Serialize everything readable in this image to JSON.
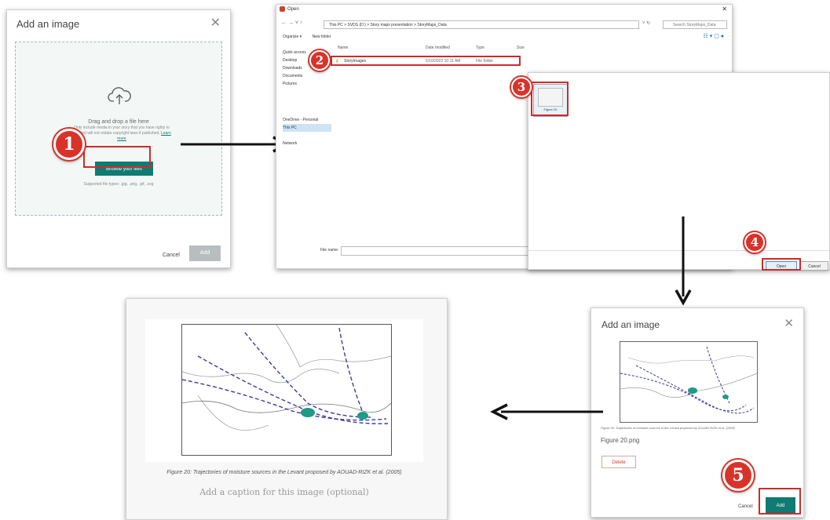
{
  "panel1": {
    "title": "Add an image",
    "drag_text": "Drag and drop a file here",
    "info_text": "Only include media in your story that you have rights to use and will not violate copyright laws if published.",
    "learn_more": "Learn more",
    "browse_label": "Browse your files",
    "supported_types": "Supported file types: .jpg, .png, .gif, .svg",
    "cancel_label": "Cancel",
    "add_label": "Add",
    "step": "1"
  },
  "panel2": {
    "title": "Open",
    "address": "This PC  >  SVDS (D:)  >  Story maps presentation  >  StoryMaps_Data",
    "search_placeholder": "Search StoryMaps_Data",
    "toolbar": [
      "Organize ▾",
      "New folder"
    ],
    "nav_items": [
      "Quick access",
      "Desktop",
      "Downloads",
      "Documents",
      "Pictures",
      "OneDrive - Personal",
      "This PC",
      "Network"
    ],
    "columns": [
      "Name",
      "Date modified",
      "Type",
      "Size"
    ],
    "row": {
      "name": "StoryImages",
      "date": "5/10/2022 10:11 AM",
      "type": "File folder"
    },
    "file_name_label": "File name:",
    "step": "2"
  },
  "panel3": {
    "file_label": "Figure 20",
    "open_label": "Open",
    "cancel_label": "Cancel",
    "step3": "3",
    "step4": "4"
  },
  "panel4": {
    "title": "Add an image",
    "caption": "Figure 20: Trajectories of moisture sources in the Levant proposed by AOUAD-RIZK et al. (2005)",
    "file_name": "Figure 20.png",
    "delete_label": "Delete",
    "cancel_label": "Cancel",
    "add_label": "Add",
    "step": "5"
  },
  "panel5": {
    "caption": "Figure 20: Trajectories of moisture sources in the Levant proposed by AOUAD-RIZK et al. (2005)",
    "add_caption_placeholder": "Add a caption for this image (optional)"
  },
  "colors": {
    "accent": "#0f7b72",
    "highlight": "#d02a2a"
  }
}
